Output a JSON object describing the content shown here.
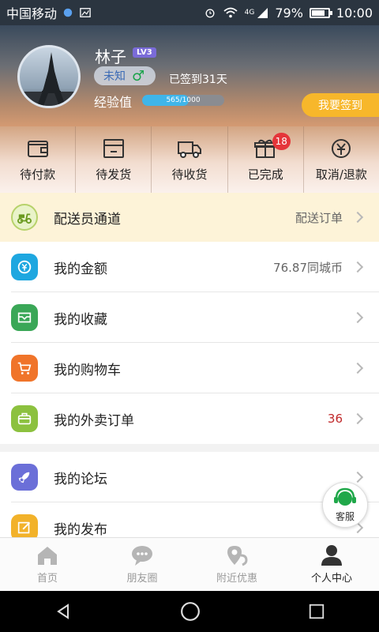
{
  "status_bar": {
    "carrier": "中国移动",
    "network": "4G",
    "battery": "79%",
    "battery_level": 0.79,
    "time": "10:00"
  },
  "profile": {
    "name": "林子",
    "level": "LV3",
    "gender_text": "未知",
    "gender_symbol": "♂",
    "sign_days": "已签到31天",
    "exp_label": "经验值",
    "exp_text": "565/1000",
    "exp_progress": 0.565,
    "sign_button": "我要签到"
  },
  "orders": [
    {
      "label": "待付款",
      "icon": "wallet-icon"
    },
    {
      "label": "待发货",
      "icon": "box-icon"
    },
    {
      "label": "待收货",
      "icon": "truck-icon"
    },
    {
      "label": "已完成",
      "icon": "gift-icon",
      "badge": "18"
    },
    {
      "label": "取消/退款",
      "icon": "refund-icon"
    }
  ],
  "rider": {
    "title": "配送员通道",
    "value": "配送订单"
  },
  "menu": [
    {
      "title": "我的金额",
      "value": "76.87同城币",
      "icon": "coin-icon",
      "color": "#1ea7e0"
    },
    {
      "title": "我的收藏",
      "value": "",
      "icon": "favorite-icon",
      "color": "#3aa757"
    },
    {
      "title": "我的购物车",
      "value": "",
      "icon": "cart-icon",
      "color": "#f0742a"
    },
    {
      "title": "我的外卖订单",
      "value": "36",
      "icon": "takeout-icon",
      "color": "#8cc13f"
    },
    {
      "title": "我的论坛",
      "value": "",
      "icon": "rocket-icon",
      "color": "#6b6fd8"
    },
    {
      "title": "我的发布",
      "value": "",
      "icon": "edit-icon",
      "color": "#f2b22a"
    }
  ],
  "service": {
    "label": "客服"
  },
  "tabs": [
    {
      "label": "首页",
      "icon": "home-icon"
    },
    {
      "label": "朋友圈",
      "icon": "chat-icon"
    },
    {
      "label": "附近优惠",
      "icon": "location-icon"
    },
    {
      "label": "个人中心",
      "icon": "user-icon",
      "active": true
    }
  ],
  "colors": {
    "accent": "#f7b72b",
    "badge": "#e5353a",
    "takeout_count": "#c0282a"
  }
}
